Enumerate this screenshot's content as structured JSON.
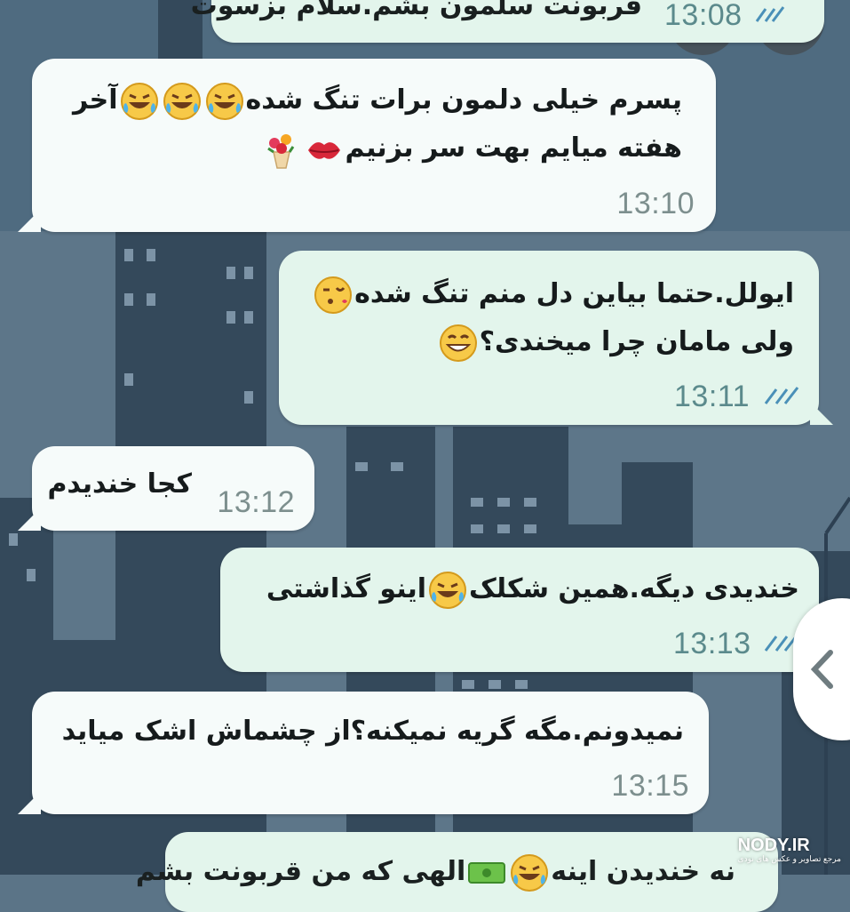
{
  "colors": {
    "incoming_bubble": "#f6fbfa",
    "outgoing_bubble": "#e3f5ec",
    "timestamp": "#7d8f8e",
    "read_ticks": "#4a90b8",
    "wallpaper": "#5b7487"
  },
  "top_actions": [
    {
      "icon": "visual-search-icon"
    },
    {
      "icon": "share-icon"
    }
  ],
  "messages": [
    {
      "side": "out",
      "lines": [
        "قربونت سلمون بشم.سلام بزسوت"
      ],
      "time": "13:08",
      "ticks": "read"
    },
    {
      "side": "in",
      "lines": [
        "پسرم خیلی دلمون برات تنگ شده",
        "هفته میایم بهت سر بزنیم"
      ],
      "line1_tail": "آخر",
      "time": "13:10"
    },
    {
      "side": "out",
      "lines": [
        "ایولل.حتما بیاین دل منم تنگ شده",
        "ولی مامان چرا میخندی؟"
      ],
      "time": "13:11",
      "ticks": "read"
    },
    {
      "side": "in",
      "lines": [
        "کجا خندیدم"
      ],
      "time": "13:12"
    },
    {
      "side": "out",
      "lines": [
        "خندیدی دیگه.همین شکلک",
        "اینو گذاشتی"
      ],
      "time": "13:13",
      "ticks": "read"
    },
    {
      "side": "in",
      "lines": [
        "نمیدونم.مگه گریه نمیکنه؟از چشماش اشک میاید"
      ],
      "time": "13:15"
    },
    {
      "side": "out",
      "lines": [
        "نه خندیدن اینه",
        "الهی که من قربونت بشم"
      ],
      "time": ""
    }
  ],
  "emojis": {
    "laugh_tears": "face-with-tears-of-joy",
    "kiss": "face-blowing-kiss",
    "lips": "kiss-mark",
    "flowers": "bouquet",
    "grin": "grinning-face",
    "bill": "money-banknote"
  },
  "nav": {
    "back_icon": "chevron-left-icon"
  },
  "watermark": {
    "title": "NODY.IR",
    "subtitle": "مرجع تصاویر و عکس های نودی"
  }
}
